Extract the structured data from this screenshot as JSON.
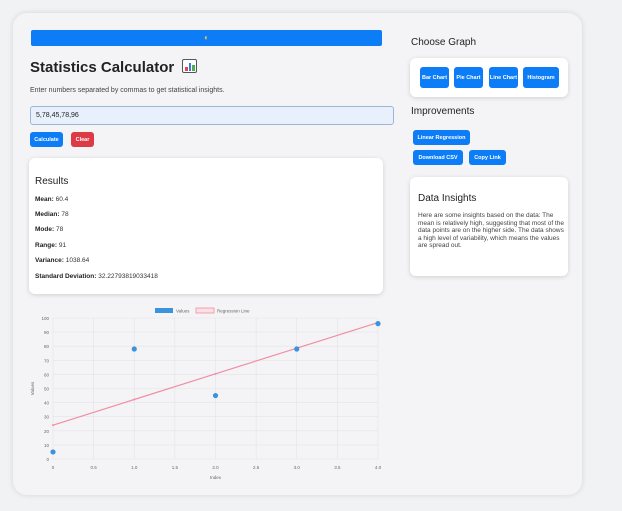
{
  "app": {
    "title": "Statistics Calculator",
    "instructions": "Enter numbers separated by commas to get statistical insights.",
    "input_value": "5,78,45,78,96",
    "calculate_label": "Calculate",
    "clear_label": "Clear"
  },
  "results": {
    "title": "Results",
    "items": [
      {
        "label": "Mean:",
        "value": "60.4"
      },
      {
        "label": "Median:",
        "value": "78"
      },
      {
        "label": "Mode:",
        "value": "78"
      },
      {
        "label": "Range:",
        "value": "91"
      },
      {
        "label": "Variance:",
        "value": "1038.64"
      },
      {
        "label": "Standard Deviation:",
        "value": "32.22793819033418"
      }
    ]
  },
  "choose_graph": {
    "title": "Choose Graph",
    "buttons": [
      "Bar Chart",
      "Pie Chart",
      "Line Chart",
      "Histogram"
    ]
  },
  "improvements": {
    "title": "Improvements",
    "linear_regression": "Linear Regression",
    "download_csv": "Download CSV",
    "copy_link": "Copy Link"
  },
  "insights": {
    "title": "Data Insights",
    "text": "Here are some insights based on the data: The mean is relatively high, suggesting that most of the data points are on the higher side. The data shows a high level of variability, which means the values are spread out."
  },
  "colors": {
    "accent": "#0d7df7",
    "danger": "#dc3a45",
    "values_series": "#3a93dc",
    "regression_series": "#f08fa2"
  },
  "chart_data": {
    "type": "scatter",
    "xlabel": "Index",
    "ylabel": "Values",
    "xlim": [
      0,
      4
    ],
    "ylim": [
      0,
      100
    ],
    "x_ticks": [
      "0",
      "0.5",
      "1.0",
      "1.5",
      "2.0",
      "2.5",
      "3.0",
      "3.5",
      "4.0"
    ],
    "y_ticks": [
      "0",
      "10",
      "20",
      "30",
      "40",
      "50",
      "60",
      "70",
      "80",
      "90",
      "100"
    ],
    "legend_position": "top",
    "grid": true,
    "series": [
      {
        "name": "Values",
        "kind": "scatter",
        "x": [
          0,
          1,
          2,
          3,
          4
        ],
        "y": [
          5,
          78,
          45,
          78,
          96
        ]
      },
      {
        "name": "Regression Line",
        "kind": "line",
        "x": [
          0,
          1,
          2,
          3,
          4
        ],
        "y": [
          24,
          42.2,
          60.4,
          78.6,
          96.8
        ]
      }
    ]
  }
}
